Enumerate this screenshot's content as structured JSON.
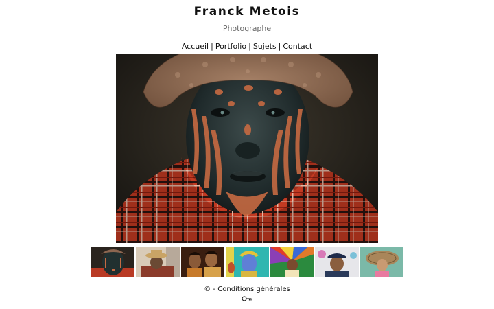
{
  "header": {
    "title": "Franck Metois",
    "subtitle": "Photographe"
  },
  "nav": {
    "items": [
      {
        "label": "Accueil"
      },
      {
        "label": "Portfolio"
      },
      {
        "label": "Sujets"
      },
      {
        "label": "Contact"
      }
    ],
    "separator": "|"
  },
  "hero": {
    "icon": "portrait-photo-painted-face"
  },
  "thumbnails": [
    {
      "icon": "thumb-painted-face"
    },
    {
      "icon": "thumb-man-hat"
    },
    {
      "icon": "thumb-women"
    },
    {
      "icon": "thumb-blue-face"
    },
    {
      "icon": "thumb-child-umbrella"
    },
    {
      "icon": "thumb-man-headdress"
    },
    {
      "icon": "thumb-child-straw-hat"
    }
  ],
  "footer": {
    "copyright": "© -",
    "terms_label": "Conditions générales",
    "login_icon": "key-icon"
  }
}
